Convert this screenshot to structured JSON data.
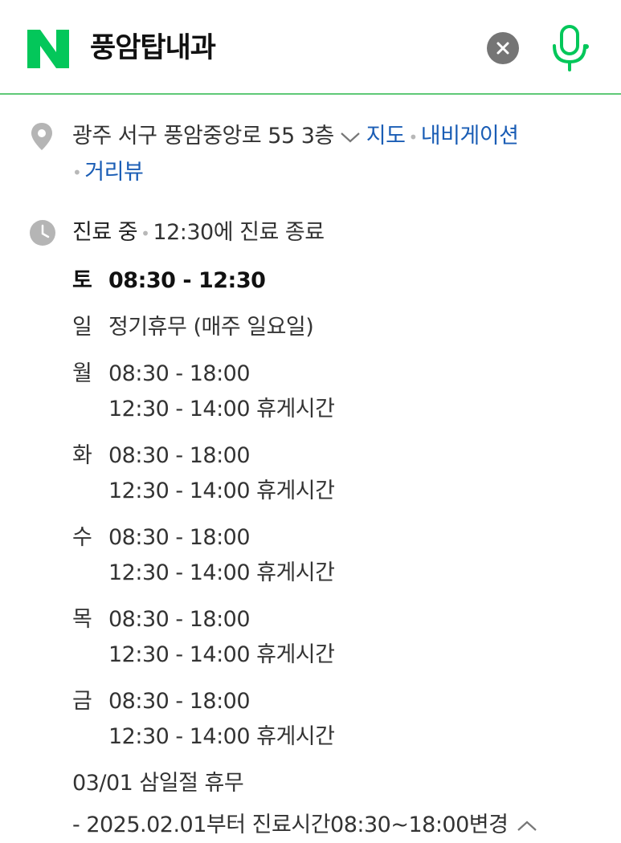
{
  "header": {
    "logo_letter": "N",
    "query": "풍암탑내과",
    "brand_color": "#03c75a",
    "underline_color": "#5fc977"
  },
  "place": {
    "address": "광주 서구 풍암중앙로 55 3층",
    "links": [
      "지도",
      "내비게이션",
      "거리뷰"
    ]
  },
  "status": {
    "state": "진료 중",
    "detail": "12:30에 진료 종료"
  },
  "hours": [
    {
      "day": "토",
      "lines": [
        "08:30 - 12:30"
      ],
      "today": true
    },
    {
      "day": "일",
      "lines": [
        "정기휴무 (매주 일요일)"
      ],
      "today": false
    },
    {
      "day": "월",
      "lines": [
        "08:30 - 18:00",
        "12:30 - 14:00 휴게시간"
      ],
      "today": false
    },
    {
      "day": "화",
      "lines": [
        "08:30 - 18:00",
        "12:30 - 14:00 휴게시간"
      ],
      "today": false
    },
    {
      "day": "수",
      "lines": [
        "08:30 - 18:00",
        "12:30 - 14:00 휴게시간"
      ],
      "today": false
    },
    {
      "day": "목",
      "lines": [
        "08:30 - 18:00",
        "12:30 - 14:00 휴게시간"
      ],
      "today": false
    },
    {
      "day": "금",
      "lines": [
        "08:30 - 18:00",
        "12:30 - 14:00 휴게시간"
      ],
      "today": false
    }
  ],
  "notes": [
    "03/01 삼일절 휴무",
    "- 2025.02.01부터 진료시간08:30~18:00변경"
  ],
  "icons": {
    "location": "location-pin-icon",
    "clock": "clock-icon",
    "clear": "clear-icon",
    "mic": "microphone-icon",
    "expand": "chevron-down-icon",
    "collapse": "chevron-up-icon"
  }
}
